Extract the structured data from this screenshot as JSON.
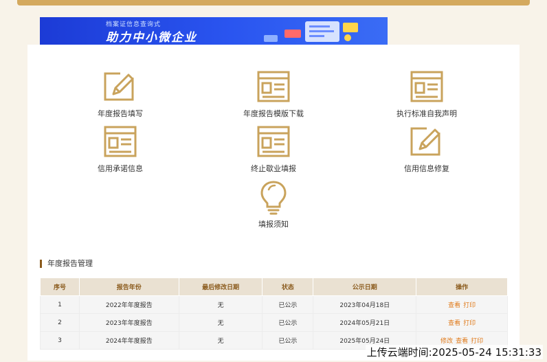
{
  "banner": {
    "subtitle": "档案证信息查询式",
    "title": "助力中小微企业"
  },
  "tiles": [
    {
      "label": "年度报告填写",
      "icon": "pencil-edit-icon"
    },
    {
      "label": "年度报告模版下载",
      "icon": "document-form-icon"
    },
    {
      "label": "执行标准自我声明",
      "icon": "document-form-icon"
    },
    {
      "label": "信用承诺信息",
      "icon": "document-form-icon"
    },
    {
      "label": "终止歇业填报",
      "icon": "document-form-icon"
    },
    {
      "label": "信用信息修复",
      "icon": "pencil-edit-icon"
    },
    {
      "label": "填报须知",
      "icon": "lightbulb-icon"
    }
  ],
  "section": {
    "title": "年度报告管理"
  },
  "table": {
    "headers": [
      "序号",
      "报告年份",
      "最后修改日期",
      "状态",
      "公示日期",
      "操作"
    ],
    "rows": [
      {
        "no": "1",
        "year": "2022年年度报告",
        "modified": "无",
        "status": "已公示",
        "date": "2023年04月18日",
        "ops": [
          "查看",
          "打印"
        ]
      },
      {
        "no": "2",
        "year": "2023年年度报告",
        "modified": "无",
        "status": "已公示",
        "date": "2024年05月21日",
        "ops": [
          "查看",
          "打印"
        ]
      },
      {
        "no": "3",
        "year": "2024年年度报告",
        "modified": "无",
        "status": "已公示",
        "date": "2025年05月24日",
        "ops": [
          "修改",
          "查看",
          "打印"
        ]
      }
    ]
  },
  "watermark": "上传云端时间:2025-05-24 15:31:33",
  "colors": {
    "accent": "#c9a35c",
    "header_bg": "#eae1d2",
    "link": "#e07a1a"
  }
}
